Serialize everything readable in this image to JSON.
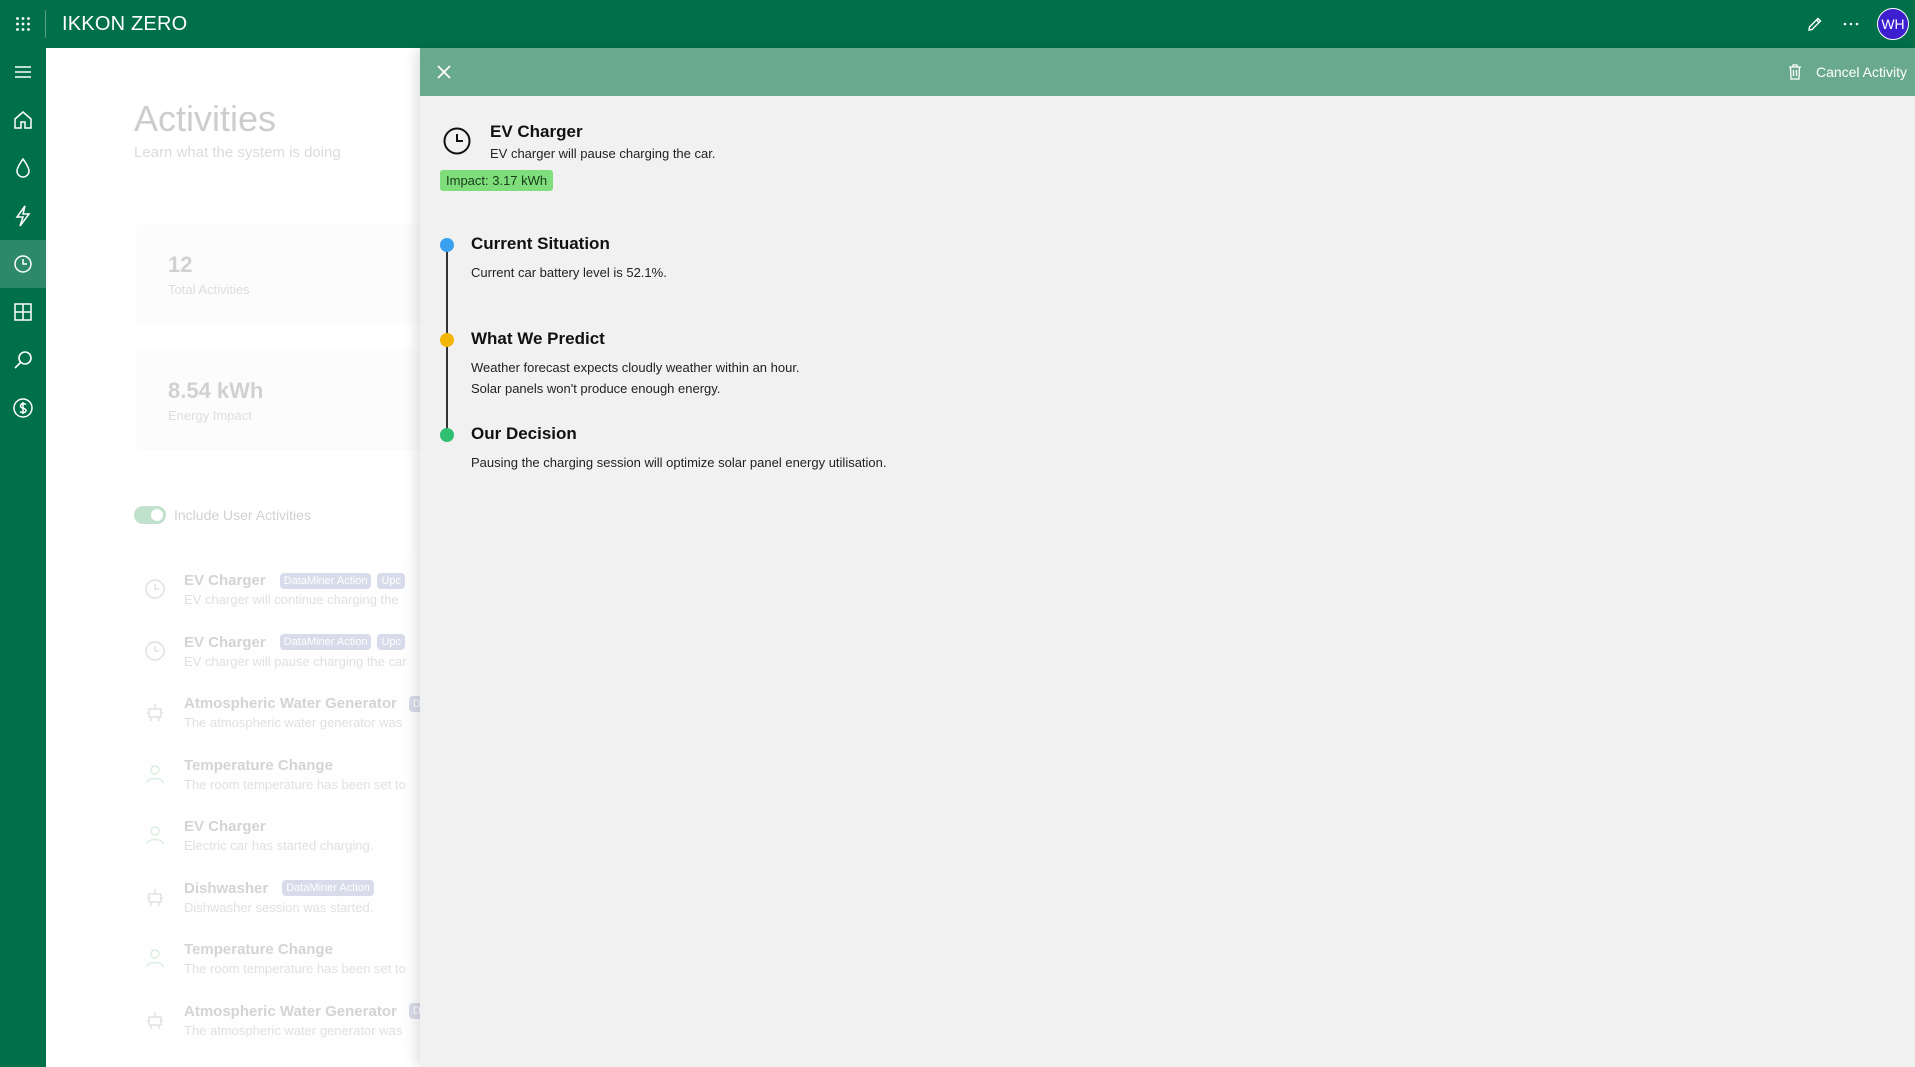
{
  "app": {
    "title": "IKKON ZERO",
    "user_initials": "WH",
    "accent_color": "#00704a"
  },
  "topbar_icons": [
    "apps-grid-icon",
    "pencil-icon",
    "more-icon"
  ],
  "rail_items": [
    {
      "name": "menu-icon"
    },
    {
      "name": "home-icon"
    },
    {
      "name": "water-drop-icon"
    },
    {
      "name": "lightning-icon"
    },
    {
      "name": "clock-icon",
      "active": true
    },
    {
      "name": "grid-icon"
    },
    {
      "name": "search-icon"
    },
    {
      "name": "dollar-icon"
    }
  ],
  "background_page": {
    "title": "Activities",
    "subtitle": "Learn what the system is doing",
    "stats": [
      {
        "value": "12",
        "label": "Total Activities"
      },
      {
        "value": "8.54 kWh",
        "label": "Energy Impact"
      }
    ],
    "toggle_label": "Include User Activities",
    "list": [
      {
        "icon": "clock-icon",
        "title": "EV Charger",
        "badge": "DataMiner Action",
        "badge2": "Upc",
        "desc": "EV charger will continue charging the"
      },
      {
        "icon": "clock-icon",
        "title": "EV Charger",
        "badge": "DataMiner Action",
        "badge2": "Upc",
        "desc": "EV charger will pause charging the car"
      },
      {
        "icon": "robot-icon",
        "title": "Atmospheric Water Generator",
        "badge": "",
        "badge2": "D",
        "desc": "The atmospheric water generator was"
      },
      {
        "icon": "user-icon",
        "title": "Temperature Change",
        "badge": "",
        "badge2": "",
        "desc": "The room temperature has been set to"
      },
      {
        "icon": "user-icon",
        "title": "EV Charger",
        "badge": "",
        "badge2": "",
        "desc": "Electric car has started charging."
      },
      {
        "icon": "robot-icon",
        "title": "Dishwasher",
        "badge": "DataMiner Action",
        "badge2": "",
        "desc": "Dishwasher session was started."
      },
      {
        "icon": "user-icon",
        "title": "Temperature Change",
        "badge": "",
        "badge2": "",
        "desc": "The room temperature has been set to"
      },
      {
        "icon": "robot-icon",
        "title": "Atmospheric Water Generator",
        "badge": "",
        "badge2": "D",
        "desc": "The atmospheric water generator was"
      }
    ]
  },
  "panel": {
    "cancel_label": "Cancel Activity",
    "activity_title": "EV Charger",
    "activity_desc": "EV charger will pause charging the car.",
    "impact": "Impact: 3.17 kWh",
    "timeline": [
      {
        "title": "Current Situation",
        "lines": [
          "Current car battery level is 52.1%."
        ],
        "color": "#3aa0f0"
      },
      {
        "title": "What We Predict",
        "lines": [
          "Weather forecast expects cloudly weather within an hour.",
          "Solar panels won't produce enough energy."
        ],
        "color": "#f2b705"
      },
      {
        "title": "Our Decision",
        "lines": [
          "Pausing the charging session will optimize solar panel energy utilisation."
        ],
        "color": "#2fbf71"
      }
    ]
  }
}
